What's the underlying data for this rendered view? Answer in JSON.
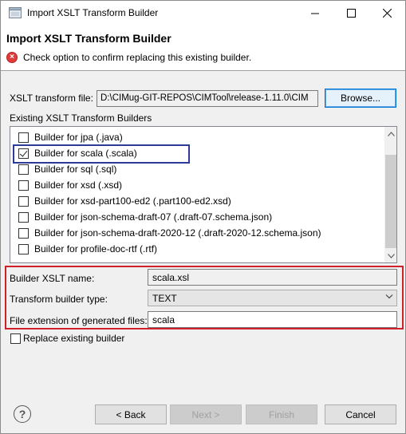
{
  "window": {
    "title": "Import XSLT Transform Builder"
  },
  "banner": {
    "title": "Import XSLT Transform Builder",
    "message": "Check option to confirm replacing this existing builder."
  },
  "xslt_file": {
    "label": "XSLT transform file:",
    "value": "D:\\CIMug-GIT-REPOS\\CIMTool\\release-1.11.0\\CIM",
    "browse_label": "Browse..."
  },
  "existing": {
    "label": "Existing XSLT Transform Builders",
    "items": [
      {
        "label": "Builder for jpa  (.java)",
        "checked": false
      },
      {
        "label": "Builder for scala  (.scala)",
        "checked": true
      },
      {
        "label": "Builder for sql  (.sql)",
        "checked": false
      },
      {
        "label": "Builder for xsd  (.xsd)",
        "checked": false
      },
      {
        "label": "Builder for xsd-part100-ed2  (.part100-ed2.xsd)",
        "checked": false
      },
      {
        "label": "Builder for json-schema-draft-07  (.draft-07.schema.json)",
        "checked": false
      },
      {
        "label": "Builder for json-schema-draft-2020-12  (.draft-2020-12.schema.json)",
        "checked": false
      },
      {
        "label": "Builder for profile-doc-rtf  (.rtf)",
        "checked": false
      }
    ]
  },
  "fields": {
    "name_label": "Builder XSLT name:",
    "name_value": "scala.xsl",
    "type_label": "Transform builder type:",
    "type_value": "TEXT",
    "ext_label": "File extension of generated files:",
    "ext_value": "scala"
  },
  "replace": {
    "label": "Replace existing builder",
    "checked": false
  },
  "footer": {
    "back_label": "< Back",
    "next_label": "Next >",
    "finish_label": "Finish",
    "cancel_label": "Cancel"
  },
  "colors": {
    "highlight_blue": "#2d3a9a",
    "highlight_red": "#d0202a",
    "error_icon": "#e03b3b"
  }
}
